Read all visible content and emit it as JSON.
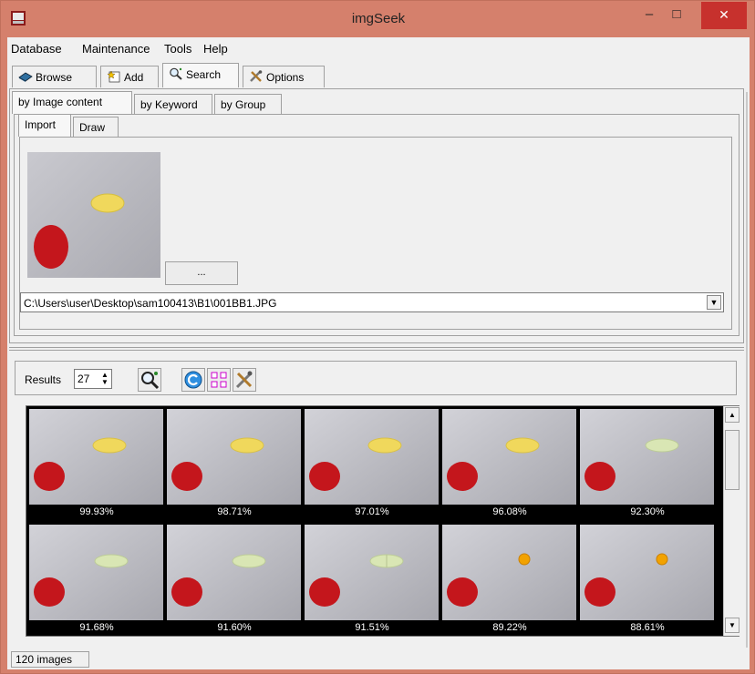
{
  "window": {
    "title": "imgSeek",
    "minimize_glyph": "–",
    "maximize_glyph": "□",
    "close_glyph": "✕"
  },
  "menu": {
    "items": [
      "Database",
      "Maintenance",
      "Tools",
      "Help"
    ]
  },
  "main_tabs": [
    {
      "label": "Browse",
      "icon": "book-icon"
    },
    {
      "label": "Add",
      "icon": "add-star-icon"
    },
    {
      "label": "Search",
      "icon": "magnifier-icon",
      "active": true
    },
    {
      "label": "Options",
      "icon": "tools-icon"
    }
  ],
  "search_tabs": [
    "by Image content",
    "by Keyword",
    "by Group"
  ],
  "source_tabs": [
    "Import",
    "Draw"
  ],
  "import": {
    "browse_label": "...",
    "path": "C:\\Users\\user\\Desktop\\sam100413\\B1\\001BB1.JPG"
  },
  "results": {
    "label": "Results",
    "count": "27",
    "buttons": [
      "magnifier-search-icon",
      "refresh-icon",
      "group-icon",
      "tools-icon"
    ]
  },
  "result_items": [
    {
      "score": "99.93%",
      "pill": "yellow"
    },
    {
      "score": "98.71%",
      "pill": "yellow"
    },
    {
      "score": "97.01%",
      "pill": "yellow"
    },
    {
      "score": "96.08%",
      "pill": "yellow"
    },
    {
      "score": "92.30%",
      "pill": "pale-green"
    },
    {
      "score": "91.68%",
      "pill": "pale-green"
    },
    {
      "score": "91.60%",
      "pill": "pale-green"
    },
    {
      "score": "91.51%",
      "pill": "pale-green-split"
    },
    {
      "score": "89.22%",
      "pill": "orange-small"
    },
    {
      "score": "88.61%",
      "pill": "orange-small"
    }
  ],
  "status": {
    "text": "120 images"
  },
  "colors": {
    "titlebar": "#d5806c",
    "close_button": "#c7312d",
    "background": "#f0f0f0",
    "red_dot": "#c4161c",
    "yellow_pill": "#f0d85c",
    "pale_green_pill": "#d9e6b4",
    "orange_pill": "#f2a200"
  }
}
